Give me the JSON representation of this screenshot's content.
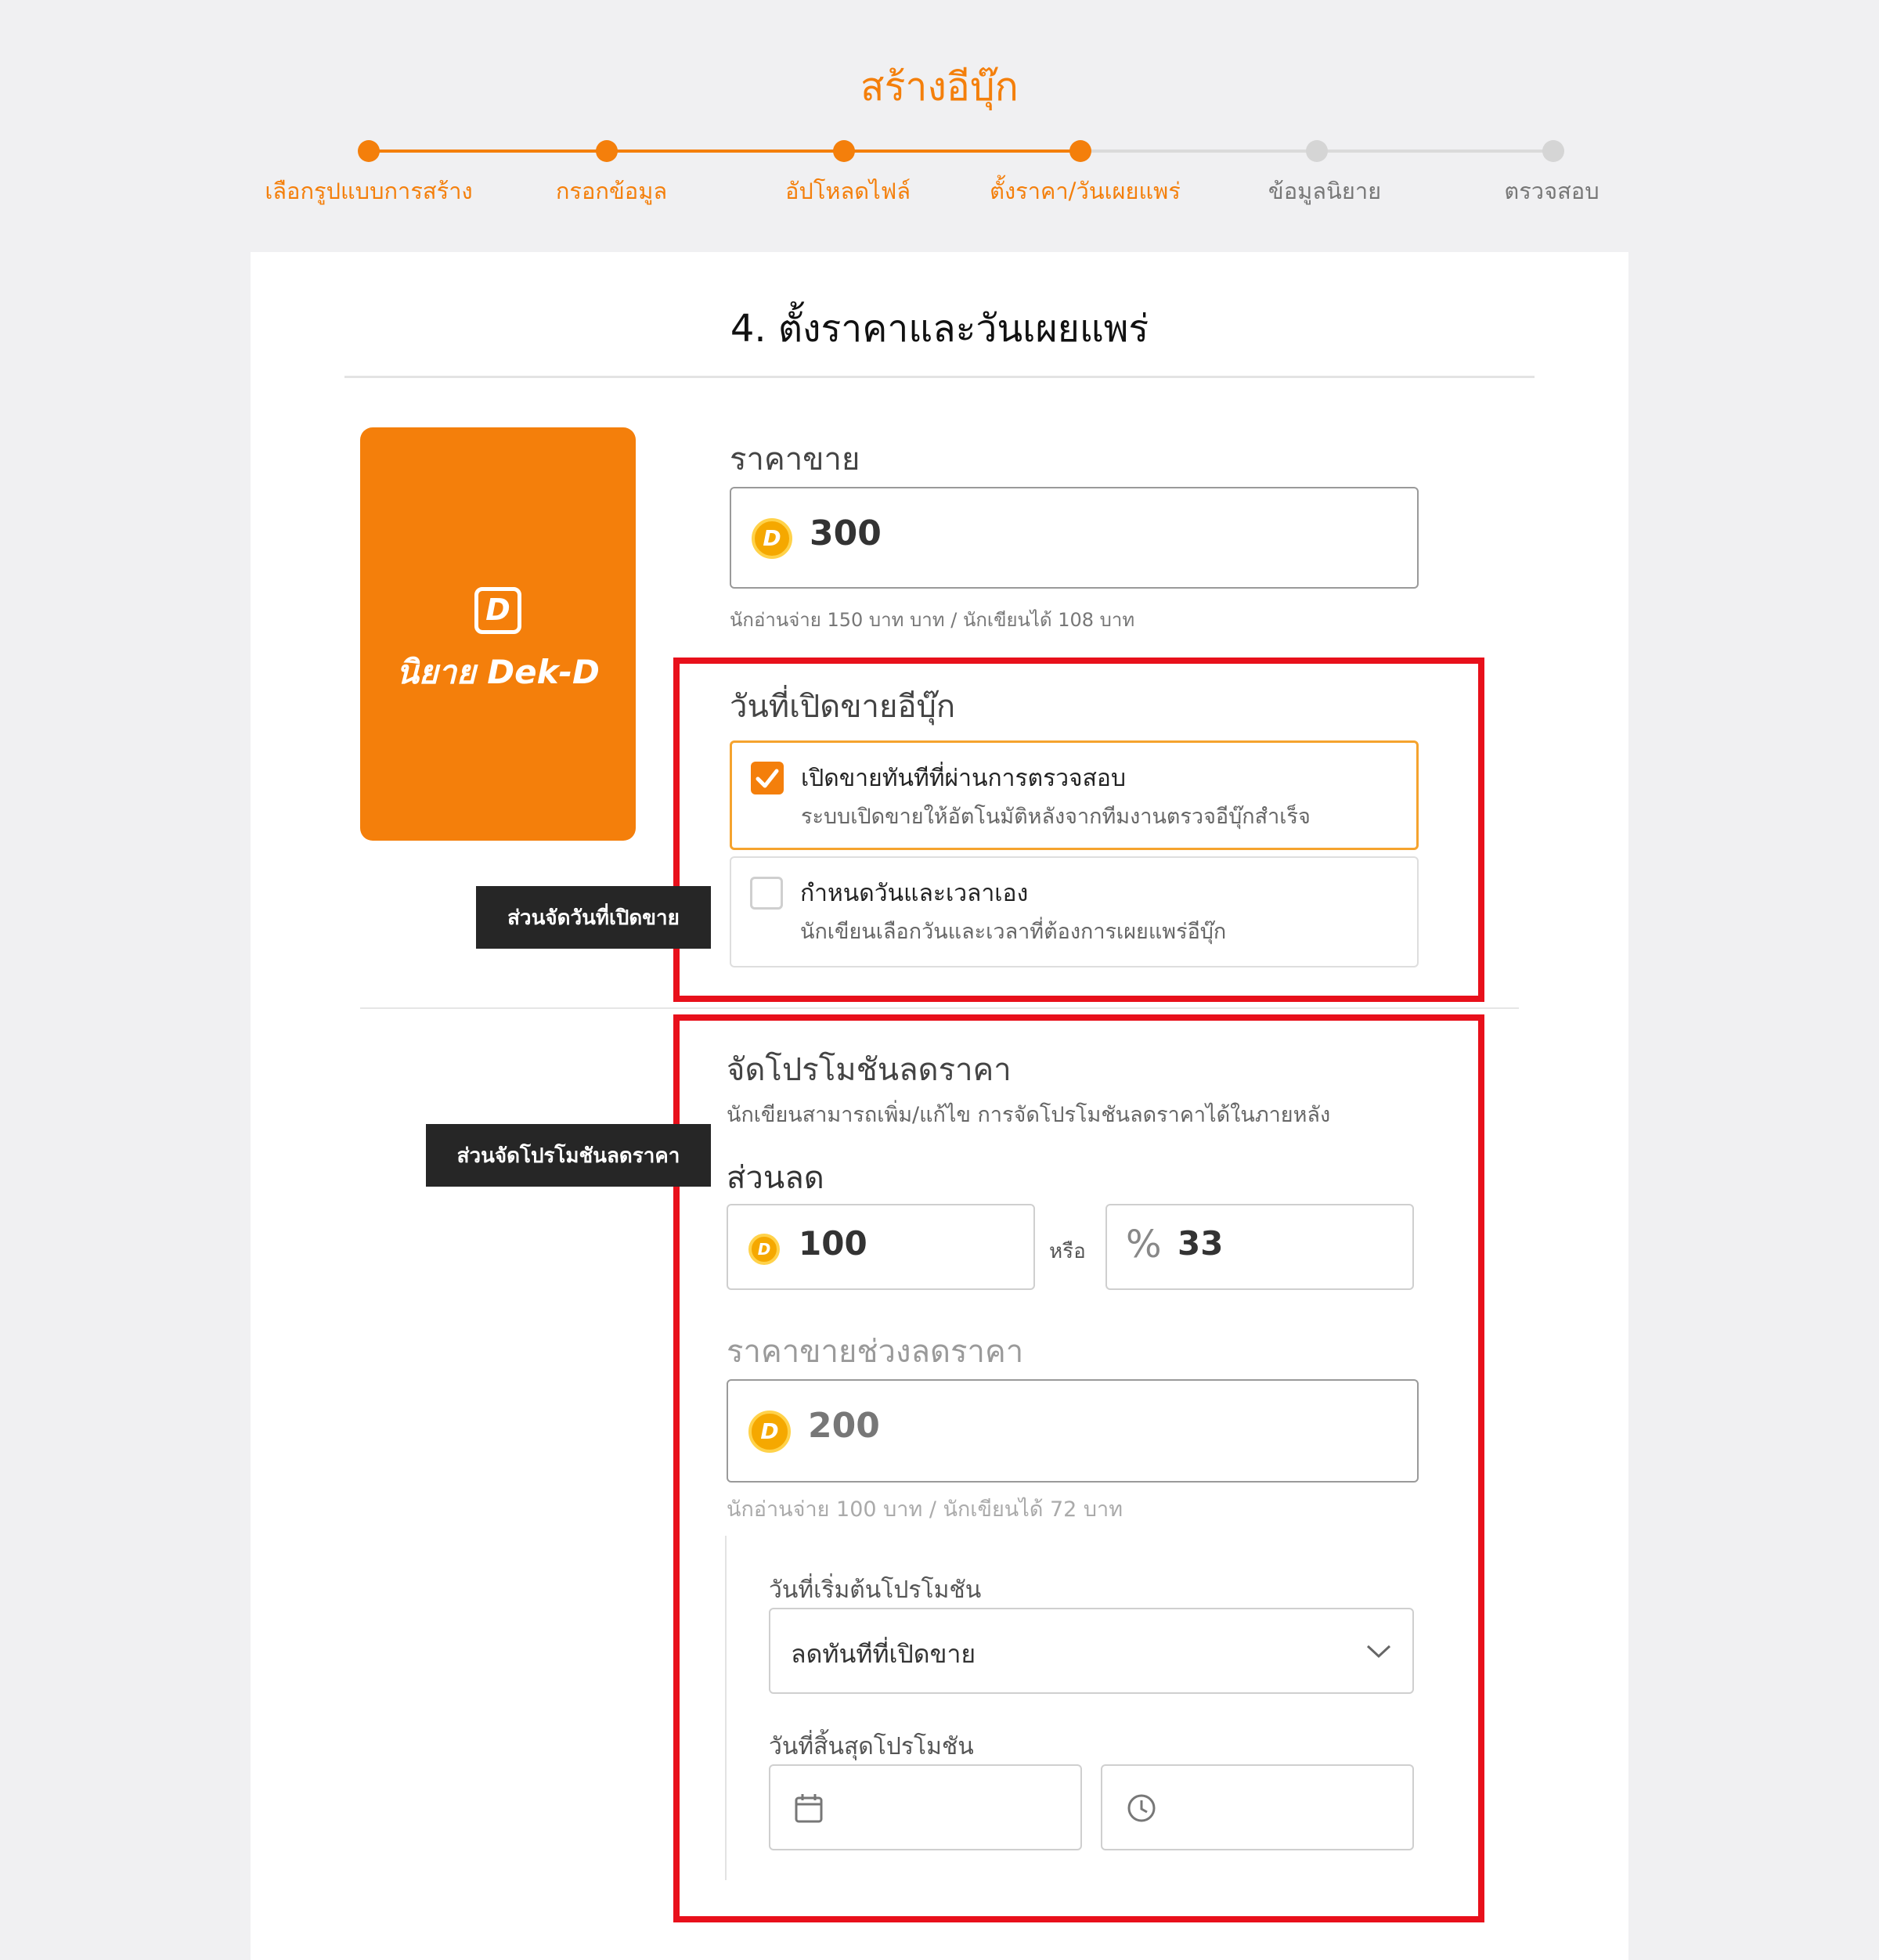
{
  "header": {
    "title": "สร้างอีบุ๊ก"
  },
  "stepper": {
    "steps": [
      {
        "label": "เลือกรูปแบบการสร้าง",
        "done": true
      },
      {
        "label": "กรอกข้อมูล",
        "done": true
      },
      {
        "label": "อัปโหลดไฟล์",
        "done": true
      },
      {
        "label": "ตั้งราคา/วันเผยแพร่",
        "done": true
      },
      {
        "label": "ข้อมูลนิยาย",
        "done": false
      },
      {
        "label": "ตรวจสอบ",
        "done": false
      }
    ]
  },
  "section": {
    "title": "4. ตั้งราคาและวันเผยแพร่"
  },
  "cover": {
    "logo_text": "นิยาย Dek-D",
    "icon_letter": "D"
  },
  "price": {
    "label": "ราคาขาย",
    "value": "300",
    "coin_letter": "D",
    "hint": "นักอ่านจ่าย 150 บาท บาท / นักเขียนได้ 108 บาท"
  },
  "release": {
    "label": "วันที่เปิดขายอีบุ๊ก",
    "options": [
      {
        "title": "เปิดขายทันทีที่ผ่านการตรวจสอบ",
        "desc": "ระบบเปิดขายให้อัตโนมัติหลังจากทีมงานตรวจอีบุ๊กสำเร็จ",
        "checked": true
      },
      {
        "title": "กำหนดวันและเวลาเอง",
        "desc": "นักเขียนเลือกวันและเวลาที่ต้องการเผยแพร่อีบุ๊ก",
        "checked": false
      }
    ]
  },
  "promotion": {
    "label": "จัดโปรโมชันลดราคา",
    "desc": "นักเขียนสามารถเพิ่ม/แก้ไข การจัดโปรโมชันลดราคาได้ในภายหลัง",
    "discount_label": "ส่วนลด",
    "discount_amount": "100",
    "or_text": "หรือ",
    "percent_symbol": "%",
    "discount_percent": "33",
    "sale_price_label": "ราคาขายช่วงลดราคา",
    "sale_price": "200",
    "sale_hint": "นักอ่านจ่าย 100 บาท / นักเขียนได้ 72 บาท",
    "start_label": "วันที่เริ่มต้นโปรโมชัน",
    "start_value": "ลดทันทีที่เปิดขาย",
    "end_label": "วันที่สิ้นสุดโปรโมชัน",
    "end_date_value": "",
    "end_time_value": ""
  },
  "annotations": {
    "release_callout": "ส่วนจัดวันที่เปิดขาย",
    "promo_callout": "ส่วนจัดโปรโมชันลดราคา"
  },
  "colors": {
    "accent": "#f47f0b",
    "highlight_border": "#e8101b",
    "callout_bg": "#262626",
    "coin": "#f5a800",
    "inactive": "#d5d5d5"
  }
}
